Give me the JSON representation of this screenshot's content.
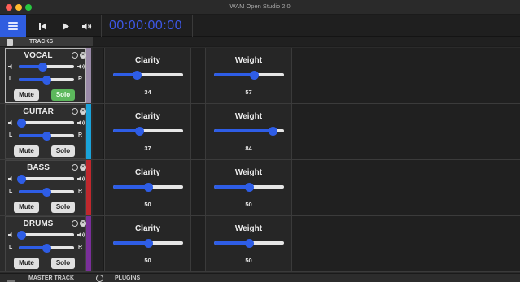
{
  "window": {
    "title": "WAM Open Studio 2.0",
    "traffic_lights": [
      "#ff5f57",
      "#febc2e",
      "#28c840"
    ]
  },
  "toolbar": {
    "menu_icon": "hamburger-icon",
    "skip_back_icon": "skip-back-icon",
    "play_icon": "play-icon",
    "volume_icon": "speaker-icon",
    "time": "00:00:00:00",
    "accent": "#2f5de0"
  },
  "tracks_header": {
    "label": "TRACKS"
  },
  "tracks": [
    {
      "name": "VOCAL",
      "color": "#9a8aa8",
      "volume": 0.42,
      "pan": 0.5,
      "mute_label": "Mute",
      "solo_label": "Solo",
      "solo_active": true,
      "selected": true,
      "plugins": [
        {
          "name": "Clarity",
          "value": "34",
          "level": 0.34
        },
        {
          "name": "Weight",
          "value": "57",
          "level": 0.57
        }
      ]
    },
    {
      "name": "GUITAR",
      "color": "#1aa3d9",
      "volume": 0.05,
      "pan": 0.5,
      "mute_label": "Mute",
      "solo_label": "Solo",
      "solo_active": false,
      "selected": false,
      "plugins": [
        {
          "name": "Clarity",
          "value": "37",
          "level": 0.37
        },
        {
          "name": "Weight",
          "value": "84",
          "level": 0.84
        }
      ]
    },
    {
      "name": "BASS",
      "color": "#c0282d",
      "volume": 0.05,
      "pan": 0.5,
      "mute_label": "Mute",
      "solo_label": "Solo",
      "solo_active": false,
      "selected": false,
      "plugins": [
        {
          "name": "Clarity",
          "value": "50",
          "level": 0.5
        },
        {
          "name": "Weight",
          "value": "50",
          "level": 0.5
        }
      ]
    },
    {
      "name": "DRUMS",
      "color": "#7a2f9a",
      "volume": 0.05,
      "pan": 0.5,
      "mute_label": "Mute",
      "solo_label": "Solo",
      "solo_active": false,
      "selected": false,
      "plugins": [
        {
          "name": "Clarity",
          "value": "50",
          "level": 0.5
        },
        {
          "name": "Weight",
          "value": "50",
          "level": 0.5
        }
      ]
    }
  ],
  "bottom_bar": {
    "master_label": "MASTER TRACK",
    "plugins_label": "PLUGINS",
    "master_icon": "mixer-icon",
    "plugins_icon": "plugin-icon"
  }
}
